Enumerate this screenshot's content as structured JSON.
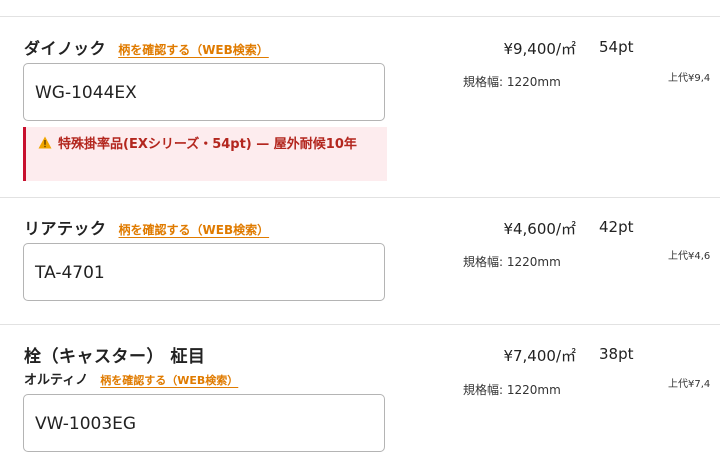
{
  "products": [
    {
      "brand": "ダイノック",
      "search_link": "柄を確認する（WEB検索）",
      "code": "WG-1044EX",
      "price": "¥9,400/㎡",
      "spec": "規格幅: 1220mm",
      "pt": "54pt",
      "upper": "上代¥9,4",
      "warning": "特殊掛率品(EXシリーズ・54pt) — 屋外耐候10年"
    },
    {
      "brand": "リアテック",
      "search_link": "柄を確認する（WEB検索）",
      "code": "TA-4701",
      "price": "¥4,600/㎡",
      "spec": "規格幅: 1220mm",
      "pt": "42pt",
      "upper": "上代¥4,6"
    },
    {
      "title": "栓（キャスター） 柾目",
      "brand": "オルティノ",
      "search_link": "柄を確認する（WEB検索）",
      "code": "VW-1003EG",
      "price": "¥7,400/㎡",
      "spec": "規格幅: 1220mm",
      "pt": "38pt",
      "upper": "上代¥7,4"
    }
  ],
  "colors": {
    "link": "#e07b00",
    "warning_text": "#b3261e",
    "warning_bg": "#fdecee",
    "warning_border": "#c8102e"
  }
}
